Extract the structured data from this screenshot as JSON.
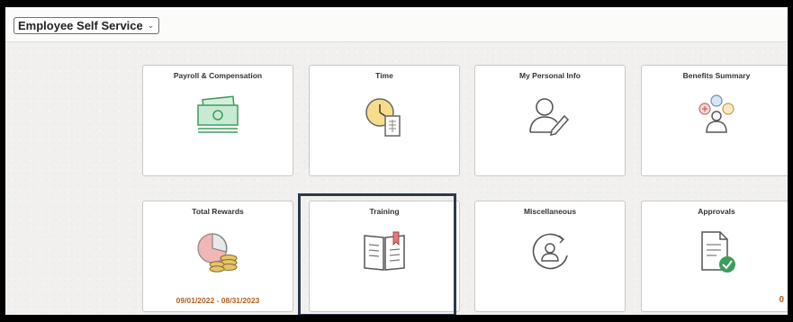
{
  "homepage_selector": {
    "label": "Employee Self Service"
  },
  "tiles": [
    {
      "title": "Payroll & Compensation",
      "icon": "money-icon"
    },
    {
      "title": "Time",
      "icon": "clock-timesheet-icon"
    },
    {
      "title": "My Personal Info",
      "icon": "person-edit-icon"
    },
    {
      "title": "Benefits Summary",
      "icon": "benefits-icon"
    },
    {
      "title": "Total Rewards",
      "icon": "pie-coins-icon",
      "footer": "09/01/2022 - 08/31/2023"
    },
    {
      "title": "Training",
      "icon": "open-book-icon"
    },
    {
      "title": "Miscellaneous",
      "icon": "person-cycle-icon"
    },
    {
      "title": "Approvals",
      "icon": "document-check-icon",
      "count": "0"
    }
  ],
  "colors": {
    "accent_green": "#3a9d5d",
    "footer_orange": "#b35c1e",
    "focus_border": "#2a3a4e"
  }
}
